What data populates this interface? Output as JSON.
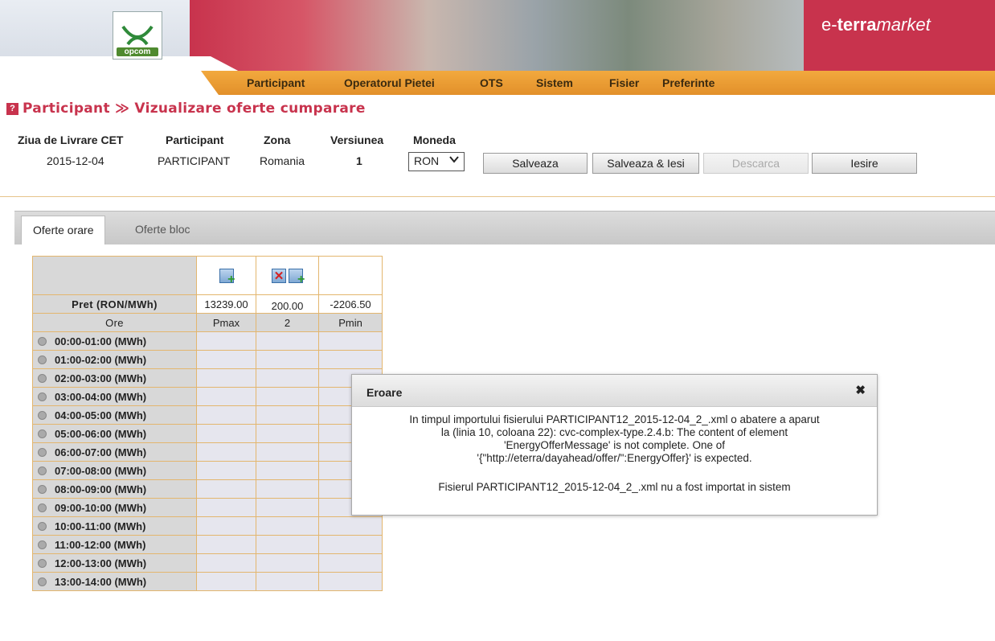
{
  "header": {
    "logo_text": "opcom",
    "brand_prefix": "e-",
    "brand_bold": "terra",
    "brand_italic": "market",
    "menu": [
      "Participant",
      "Operatorul Pietei",
      "OTS",
      "Sistem",
      "Fisier",
      "Preferinte"
    ],
    "accent_color": "#c8334d",
    "menu_color": "#e99a32"
  },
  "breadcrumb": {
    "help_icon": "?",
    "text": "Participant ≫ Vizualizare oferte cumparare"
  },
  "info": {
    "labels": [
      "Ziua de Livrare CET",
      "Participant",
      "Zona",
      "Versiunea",
      "Moneda"
    ],
    "date": "2015-12-04",
    "participant": "PARTICIPANT",
    "zone": "Romania",
    "version": "1",
    "currency": "RON"
  },
  "buttons": {
    "save": "Salveaza",
    "save_exit": "Salveaza & Iesi",
    "download": "Descarca",
    "exit": "Iesire"
  },
  "tabs": [
    "Oferte orare",
    "Oferte bloc"
  ],
  "grid": {
    "price_label": "Pret (RON/MWh)",
    "prices": [
      "13239.00",
      "200.00",
      "-2206.50"
    ],
    "hours_label": "Ore",
    "columns": [
      "Pmax",
      "2",
      "Pmin"
    ],
    "rows": [
      "00:00-01:00 (MWh)",
      "01:00-02:00 (MWh)",
      "02:00-03:00 (MWh)",
      "03:00-04:00 (MWh)",
      "04:00-05:00 (MWh)",
      "05:00-06:00 (MWh)",
      "06:00-07:00 (MWh)",
      "07:00-08:00 (MWh)",
      "08:00-09:00 (MWh)",
      "09:00-10:00 (MWh)",
      "10:00-11:00 (MWh)",
      "11:00-12:00 (MWh)",
      "12:00-13:00 (MWh)",
      "13:00-14:00 (MWh)"
    ]
  },
  "dialog": {
    "title": "Eroare",
    "close": "✖",
    "lines": [
      "In timpul importului fisierului PARTICIPANT12_2015-12-04_2_.xml o abatere a aparut",
      "la (linia 10, coloana 22): cvc-complex-type.2.4.b: The content of element",
      "'EnergyOfferMessage' is not complete. One of",
      "'{\"http://eterra/dayahead/offer/\":EnergyOffer}' is expected."
    ],
    "result": "Fisierul PARTICIPANT12_2015-12-04_2_.xml nu a fost importat in sistem"
  }
}
